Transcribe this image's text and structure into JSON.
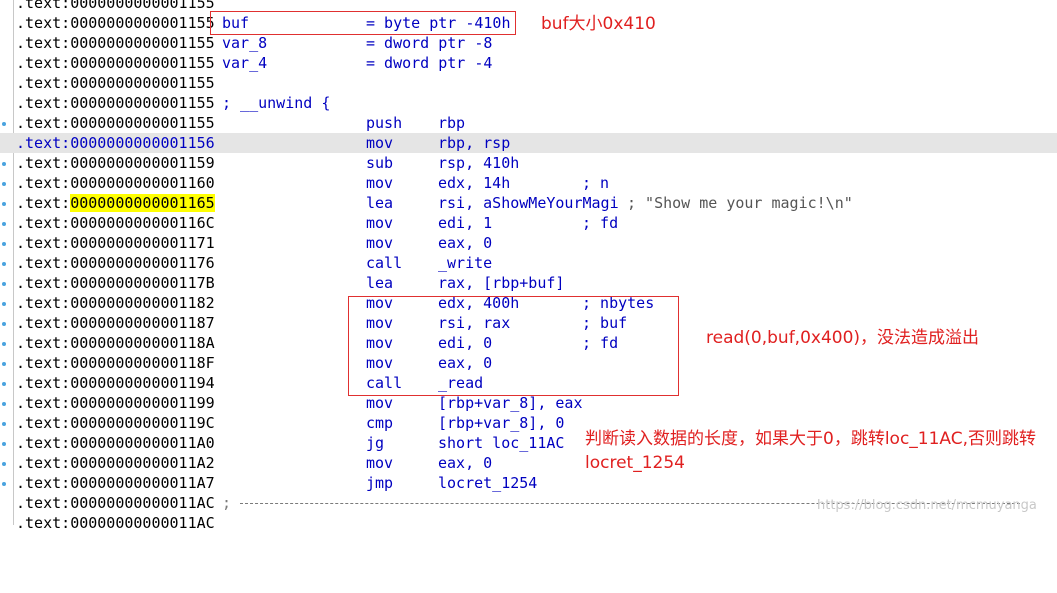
{
  "listing": {
    "lines": [
      {
        "addr_prefix": ".text:",
        "addr": "0000000000001155",
        "label": "",
        "mnem": "",
        "ops": "",
        "comment": ""
      },
      {
        "addr_prefix": ".text:",
        "addr": "0000000000001155",
        "label": "buf",
        "mnem": "= byte ptr -410h",
        "ops": "",
        "comment": ""
      },
      {
        "addr_prefix": ".text:",
        "addr": "0000000000001155",
        "label": "var_8",
        "mnem": "= dword ptr -8",
        "ops": "",
        "comment": ""
      },
      {
        "addr_prefix": ".text:",
        "addr": "0000000000001155",
        "label": "var_4",
        "mnem": "= dword ptr -4",
        "ops": "",
        "comment": ""
      },
      {
        "addr_prefix": ".text:",
        "addr": "0000000000001155",
        "label": "",
        "mnem": "",
        "ops": "",
        "comment": ""
      },
      {
        "addr_prefix": ".text:",
        "addr": "0000000000001155",
        "label": "; __unwind {",
        "mnem": "",
        "ops": "",
        "comment": ""
      },
      {
        "addr_prefix": ".text:",
        "addr": "0000000000001155",
        "label": "",
        "mnem": "push",
        "ops": "rbp",
        "comment": ""
      },
      {
        "addr_prefix": ".text:",
        "addr": "0000000000001156",
        "label": "",
        "mnem": "mov",
        "ops": "rbp, rsp",
        "comment": ""
      },
      {
        "addr_prefix": ".text:",
        "addr": "0000000000001159",
        "label": "",
        "mnem": "sub",
        "ops": "rsp, 410h",
        "comment": ""
      },
      {
        "addr_prefix": ".text:",
        "addr": "0000000000001160",
        "label": "",
        "mnem": "mov",
        "ops": "edx, 14h",
        "comment": "; n"
      },
      {
        "addr_prefix": ".text:",
        "addr": "0000000000001165",
        "label": "",
        "mnem": "lea",
        "ops": "rsi, aShowMeYourMagi",
        "comment": "",
        "string_comment": "; \"Show me your magic!\\n\""
      },
      {
        "addr_prefix": ".text:",
        "addr": "000000000000116C",
        "label": "",
        "mnem": "mov",
        "ops": "edi, 1",
        "comment": "; fd"
      },
      {
        "addr_prefix": ".text:",
        "addr": "0000000000001171",
        "label": "",
        "mnem": "mov",
        "ops": "eax, 0",
        "comment": ""
      },
      {
        "addr_prefix": ".text:",
        "addr": "0000000000001176",
        "label": "",
        "mnem": "call",
        "ops": "_write",
        "comment": ""
      },
      {
        "addr_prefix": ".text:",
        "addr": "000000000000117B",
        "label": "",
        "mnem": "lea",
        "ops": "rax, [rbp+buf]",
        "comment": ""
      },
      {
        "addr_prefix": ".text:",
        "addr": "0000000000001182",
        "label": "",
        "mnem": "mov",
        "ops": "edx, 400h",
        "comment": "; nbytes"
      },
      {
        "addr_prefix": ".text:",
        "addr": "0000000000001187",
        "label": "",
        "mnem": "mov",
        "ops": "rsi, rax",
        "comment": "; buf"
      },
      {
        "addr_prefix": ".text:",
        "addr": "000000000000118A",
        "label": "",
        "mnem": "mov",
        "ops": "edi, 0",
        "comment": "; fd"
      },
      {
        "addr_prefix": ".text:",
        "addr": "000000000000118F",
        "label": "",
        "mnem": "mov",
        "ops": "eax, 0",
        "comment": ""
      },
      {
        "addr_prefix": ".text:",
        "addr": "0000000000001194",
        "label": "",
        "mnem": "call",
        "ops": "_read",
        "comment": ""
      },
      {
        "addr_prefix": ".text:",
        "addr": "0000000000001199",
        "label": "",
        "mnem": "mov",
        "ops": "[rbp+var_8], eax",
        "comment": ""
      },
      {
        "addr_prefix": ".text:",
        "addr": "000000000000119C",
        "label": "",
        "mnem": "cmp",
        "ops": "[rbp+var_8], 0",
        "comment": ""
      },
      {
        "addr_prefix": ".text:",
        "addr": "00000000000011A0",
        "label": "",
        "mnem": "jg",
        "ops": "short loc_11AC",
        "comment": ""
      },
      {
        "addr_prefix": ".text:",
        "addr": "00000000000011A2",
        "label": "",
        "mnem": "mov",
        "ops": "eax, 0",
        "comment": ""
      },
      {
        "addr_prefix": ".text:",
        "addr": "00000000000011A7",
        "label": "",
        "mnem": "jmp",
        "ops": "locret_1254",
        "comment": ""
      },
      {
        "addr_prefix": ".text:",
        "addr": "00000000000011AC",
        "label": ";",
        "mnem": "",
        "ops": "",
        "comment": ""
      },
      {
        "addr_prefix": ".text:",
        "addr": "00000000000011AC",
        "label": "",
        "mnem": "",
        "ops": "",
        "comment": ""
      }
    ]
  },
  "annotations": {
    "buf_size": "buf大小0x410",
    "read_call": "read(0,buf,0x400)，没法造成溢出",
    "jump_note_line1": "判断读入数据的长度，如果大于0，跳转loc_11AC,否则跳转",
    "jump_note_line2": "locret_1254"
  },
  "watermark": "https://blog.csdn.net/mcmuyanga",
  "colors": {
    "address_text": "#000000",
    "code_blue": "#0000c0",
    "highlight_yellow": "#ffff00",
    "selected_row": "#e5e5e5",
    "annotation_red": "#e02020"
  }
}
